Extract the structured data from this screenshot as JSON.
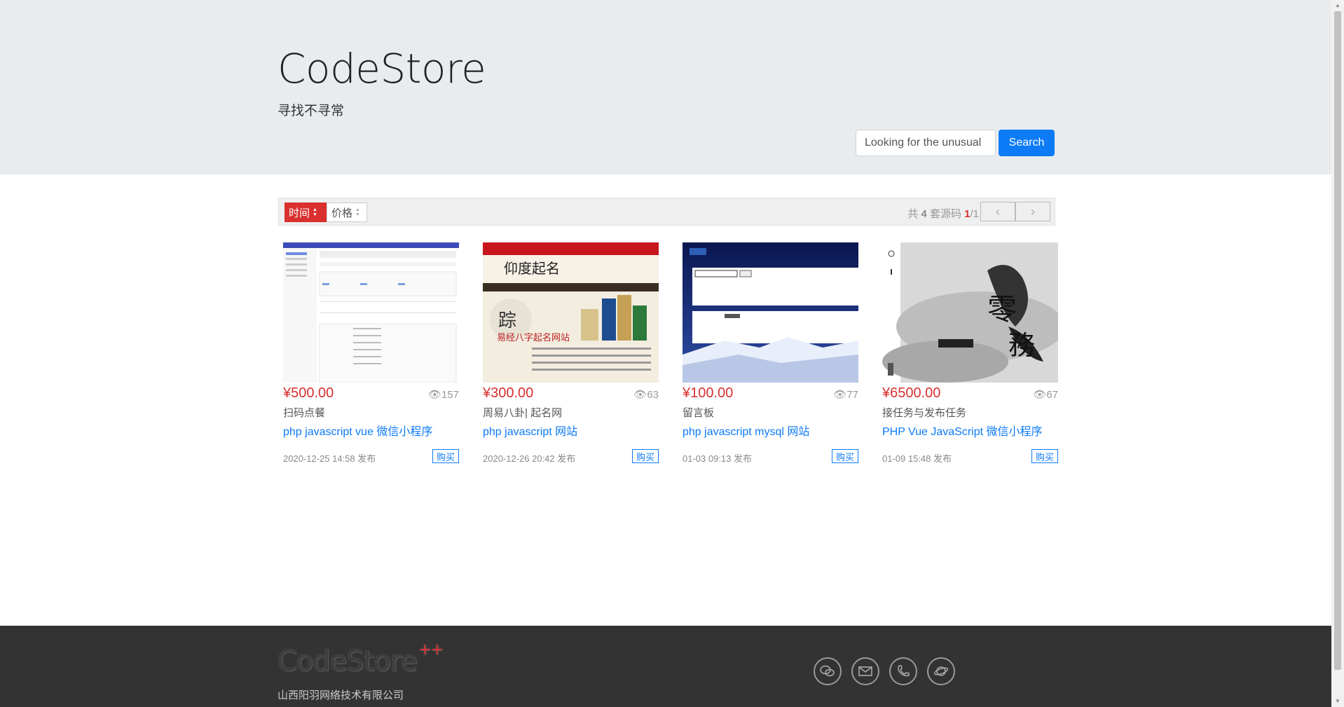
{
  "header": {
    "title": "CodeStore",
    "subtitle": "寻找不寻常"
  },
  "search": {
    "placeholder": "Looking for the unusual",
    "button_label": "Search"
  },
  "toolbar": {
    "sort_time_label": "时间",
    "sort_price_label": "价格",
    "count_prefix": "共",
    "count": "4",
    "count_suffix": "套源码",
    "page_current": "1",
    "page_total": "/1",
    "prev_label": "‹",
    "next_label": "›"
  },
  "products": [
    {
      "price": "¥500.00",
      "views": "157",
      "name": "扫码点餐",
      "tags": "php javascript vue 微信小程序",
      "date": "2020-12-25 14:58 发布",
      "buy_label": "购买"
    },
    {
      "price": "¥300.00",
      "views": "63",
      "name": "周易八卦| 起名网",
      "tags": "php javascript 网站",
      "date": "2020-12-26 20:42 发布",
      "buy_label": "购买"
    },
    {
      "price": "¥100.00",
      "views": "77",
      "name": "留言板",
      "tags": "php javascript mysql 网站",
      "date": "01-03 09:13 发布",
      "buy_label": "购买"
    },
    {
      "price": "¥6500.00",
      "views": "67",
      "name": "接任务与发布任务",
      "tags": "PHP Vue JavaScript 微信小程序",
      "date": "01-09 15:48 发布",
      "buy_label": "购买"
    }
  ],
  "footer": {
    "logo": "CodeStore",
    "logo_suffix": "++",
    "company": "山西阳羽网络技术有限公司",
    "social_icons": [
      "wechat-icon",
      "email-icon",
      "phone-icon",
      "planet-icon"
    ]
  },
  "colors": {
    "accent": "#0d7bf6",
    "price_red": "#d9302f",
    "hero_bg": "#e9ecef",
    "footer_bg": "#333333"
  }
}
